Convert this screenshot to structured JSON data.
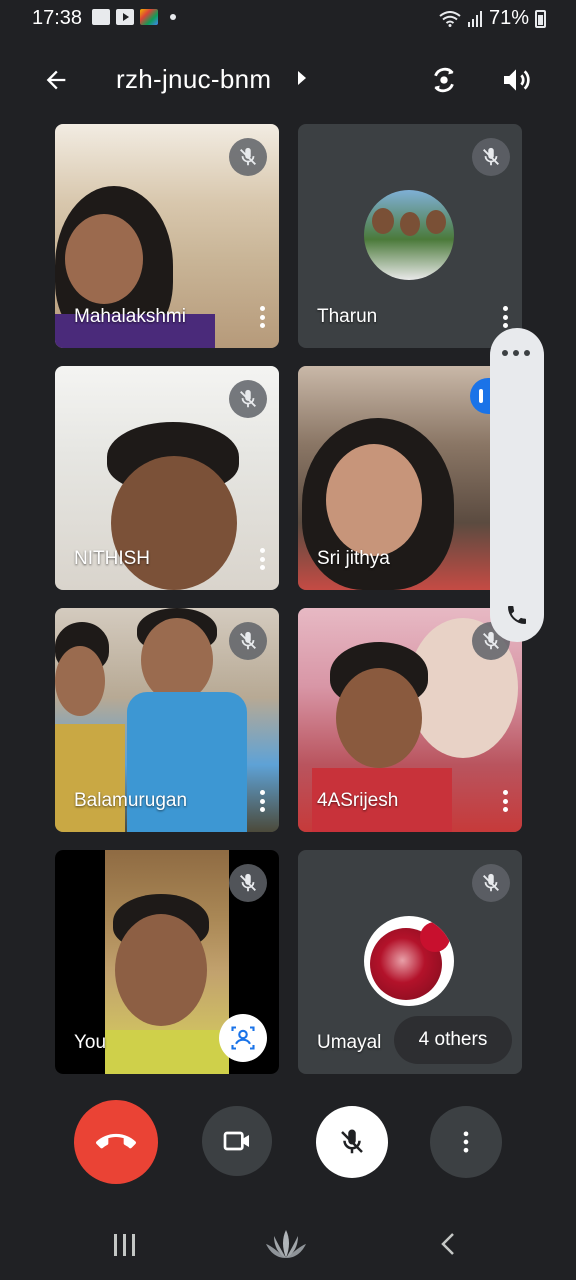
{
  "status_bar": {
    "time": "17:38",
    "battery": "71%",
    "icons": [
      "gallery-icon",
      "youtube-icon",
      "app-icon",
      "dot-icon",
      "wifi-icon",
      "signal-icon",
      "battery-icon"
    ]
  },
  "appbar": {
    "meeting_code": "rzh-jnuc-bnm",
    "icons": [
      "back-arrow-icon",
      "switch-camera-icon",
      "speaker-icon"
    ]
  },
  "participants": [
    {
      "name": "Mahalakshmi",
      "muted": true,
      "video": true
    },
    {
      "name": "Tharun",
      "muted": true,
      "video": false
    },
    {
      "name": "NITHISH",
      "muted": true,
      "video": true
    },
    {
      "name": "Sri jithya",
      "muted": false,
      "video": true
    },
    {
      "name": "Balamurugan",
      "muted": true,
      "video": true
    },
    {
      "name": "4ASrijesh",
      "muted": true,
      "video": true
    },
    {
      "name": "You",
      "muted": true,
      "video": true
    },
    {
      "name": "Umayal",
      "muted": true,
      "video": false
    }
  ],
  "others_pill": "4 others",
  "controls": {
    "end_call": "end-call-icon",
    "camera": "camera-icon",
    "mic": "mic-off-icon",
    "more": "more-vert-icon"
  },
  "colors": {
    "background": "#202124",
    "tile": "#3c4043",
    "end_call": "#ea4335",
    "accent": "#1a73e8"
  }
}
